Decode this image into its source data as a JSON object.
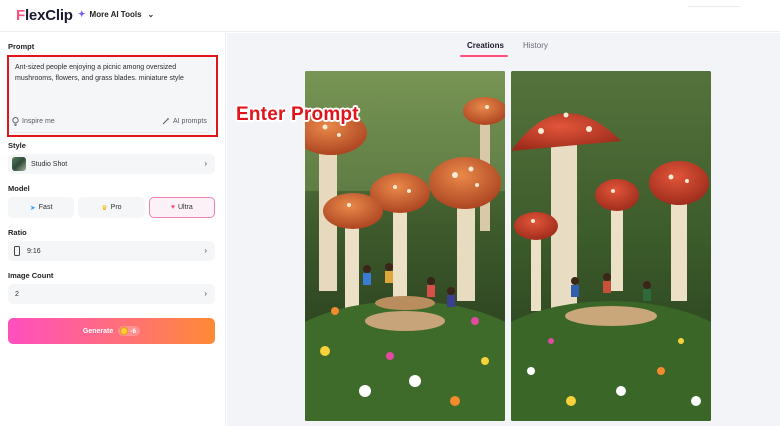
{
  "header": {
    "logo_first": "F",
    "logo_rest": "lexClip",
    "more_tools_label": "More AI Tools"
  },
  "left_panel": {
    "prompt_label": "Prompt",
    "prompt_text": "Ant-sized people enjoying a picnic among oversized mushrooms, flowers, and grass blades. miniature style",
    "inspire_label": "Inspire me",
    "ai_prompts_label": "AI prompts",
    "style_label": "Style",
    "style_value": "Studio Shot",
    "model_label": "Model",
    "models": [
      {
        "label": "Fast",
        "icon": "fast-icon",
        "selected": false
      },
      {
        "label": "Pro",
        "icon": "crown-icon",
        "selected": false
      },
      {
        "label": "Ultra",
        "icon": "heart-icon",
        "selected": true
      }
    ],
    "ratio_label": "Ratio",
    "ratio_value": "9:16",
    "image_count_label": "Image Count",
    "image_count_value": "2",
    "generate_label": "Generate",
    "generate_cost": "-6"
  },
  "right_panel": {
    "tabs": [
      {
        "label": "Creations",
        "active": true
      },
      {
        "label": "History",
        "active": false
      }
    ]
  },
  "annotation": {
    "callout_text": "Enter Prompt",
    "color": "#e0141b"
  },
  "colors": {
    "accent_pink": "#ff4f7b",
    "generate_gradient_start": "#ff4fbf",
    "generate_gradient_end": "#ff8a35",
    "selected_model_border": "#f080b8"
  }
}
